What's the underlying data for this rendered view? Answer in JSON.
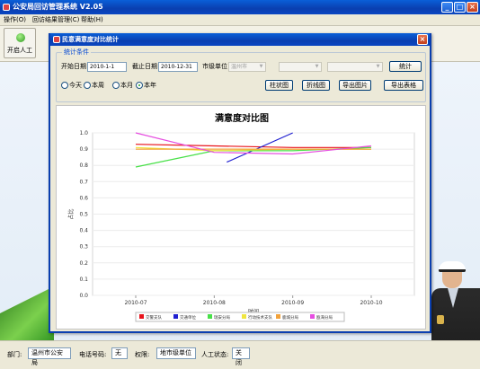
{
  "app": {
    "title": "公安局回访管理系统 V2.05",
    "window_buttons": {
      "minimize": "_",
      "maximize": "□",
      "close": "×"
    }
  },
  "menu": [
    {
      "label": "操作(O)"
    },
    {
      "label": "回访结果管理(C)"
    },
    {
      "label": "帮助(H)"
    }
  ],
  "toolbar": {
    "start_label": "开启人工",
    "start_icon": "green-ball-icon"
  },
  "dialog": {
    "title": "民意满意度对比统计",
    "close": "×",
    "group_title": "统计条件",
    "start_label": "开始日期",
    "start_value": "2010-1-1",
    "end_label": "截止日期",
    "end_value": "2010-12-31",
    "unit_label": "市级单位",
    "unit_value": "温州市",
    "select2_value": "",
    "select3_value": "",
    "stat_button": "统计",
    "radios": [
      {
        "label": "今天",
        "checked": false
      },
      {
        "label": "本周",
        "checked": false
      },
      {
        "label": "本月",
        "checked": false
      },
      {
        "label": "本年",
        "checked": true
      }
    ],
    "buttons": [
      "柱状图",
      "折线图",
      "导出图片",
      "导出表格"
    ]
  },
  "chart_data": {
    "type": "line",
    "title": "满意度对比图",
    "xlabel": "时间",
    "ylabel": "占比",
    "x": [
      "2010-07",
      "2010-08",
      "2010-09",
      "2010-10"
    ],
    "ylim": [
      0,
      1.0
    ],
    "yticks": [
      "0.0",
      "0.1",
      "0.2",
      "0.3",
      "0.4",
      "0.5",
      "0.6",
      "0.7",
      "0.8",
      "0.9",
      "1.0"
    ],
    "grid": true,
    "legend_position": "bottom",
    "series": [
      {
        "name": "交警支队",
        "color": "#e8131b",
        "points": [
          [
            0,
            0.93
          ],
          [
            1,
            0.92
          ],
          [
            2,
            0.91
          ],
          [
            3,
            0.91
          ]
        ]
      },
      {
        "name": "交通单位",
        "color": "#1f1fd0",
        "points": [
          [
            1.16,
            0.82
          ],
          [
            2.0,
            1.0
          ]
        ]
      },
      {
        "name": "瑞安分局",
        "color": "#48e048",
        "points": [
          [
            0,
            0.79
          ],
          [
            1,
            0.89
          ],
          [
            2,
            0.89
          ],
          [
            3,
            0.91
          ]
        ]
      },
      {
        "name": "行动技术支队",
        "color": "#f0e640",
        "points": [
          [
            0,
            0.91
          ],
          [
            1,
            0.89
          ],
          [
            2,
            0.9
          ],
          [
            3,
            0.9
          ]
        ]
      },
      {
        "name": "鹿城分局",
        "color": "#f2a23a",
        "points": [
          [
            0,
            0.9
          ],
          [
            1,
            0.9
          ],
          [
            2,
            0.9
          ],
          [
            3,
            0.9
          ]
        ]
      },
      {
        "name": "瓯海分局",
        "color": "#e64ee0",
        "points": [
          [
            0,
            1.0
          ],
          [
            1,
            0.88
          ],
          [
            2,
            0.87
          ],
          [
            3,
            0.92
          ]
        ]
      }
    ]
  },
  "status": {
    "dept_label": "部门:",
    "dept_value": "温州市公安局",
    "phone_label": "电话号码:",
    "phone_value": "无",
    "perm_label": "权限:",
    "perm_value": "地市级单位",
    "manual_label": "人工状态:",
    "manual_value": "关闭"
  }
}
